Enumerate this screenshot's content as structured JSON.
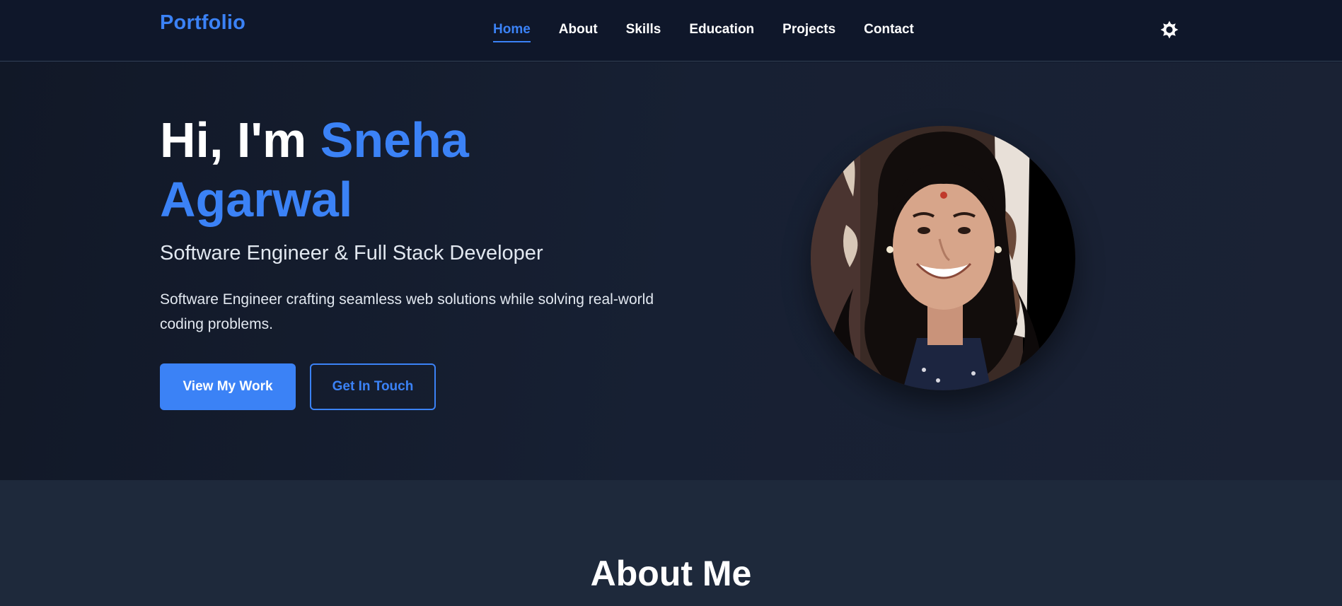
{
  "nav": {
    "brand": "Portfolio",
    "links": [
      "Home",
      "About",
      "Skills",
      "Education",
      "Projects",
      "Contact"
    ],
    "active": "Home",
    "theme_icon": "sun-icon"
  },
  "hero": {
    "greeting": "Hi, I'm ",
    "name": "Sneha Agarwal",
    "subtitle": "Software Engineer & Full Stack Developer",
    "description": "Software Engineer crafting seamless web solutions while solving real-world coding problems.",
    "primary_button": "View My Work",
    "secondary_button": "Get In Touch"
  },
  "about": {
    "title": "About Me"
  },
  "colors": {
    "accent": "#3b82f6",
    "background": "#0f172a",
    "section_alt": "#1e293b"
  }
}
